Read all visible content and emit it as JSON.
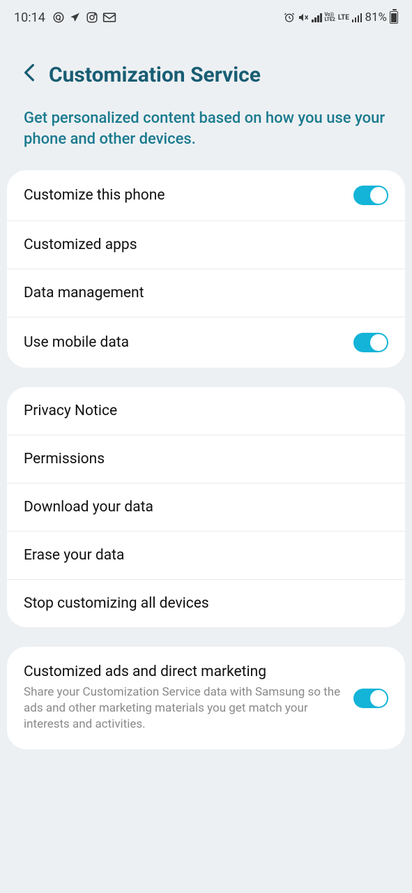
{
  "status": {
    "time": "10:14",
    "battery_pct": "81%",
    "lte_top": "Vo))",
    "lte_bot": "LTE2",
    "lte_label": "LTE"
  },
  "header": {
    "title": "Customization Service"
  },
  "subtitle": "Get personalized content based on how you use your phone and other devices.",
  "group1": {
    "customize_phone": "Customize this phone",
    "customized_apps": "Customized apps",
    "data_management": "Data management",
    "use_mobile_data": "Use mobile data"
  },
  "group2": {
    "privacy_notice": "Privacy Notice",
    "permissions": "Permissions",
    "download_data": "Download your data",
    "erase_data": "Erase your data",
    "stop_customizing": "Stop customizing all devices"
  },
  "group3": {
    "ads_title": "Customized ads and direct marketing",
    "ads_desc": "Share your Customization Service data with Samsung so the ads and other marketing materials you get match your interests and activities."
  },
  "toggles": {
    "customize_phone": true,
    "use_mobile_data": true,
    "ads": true
  }
}
